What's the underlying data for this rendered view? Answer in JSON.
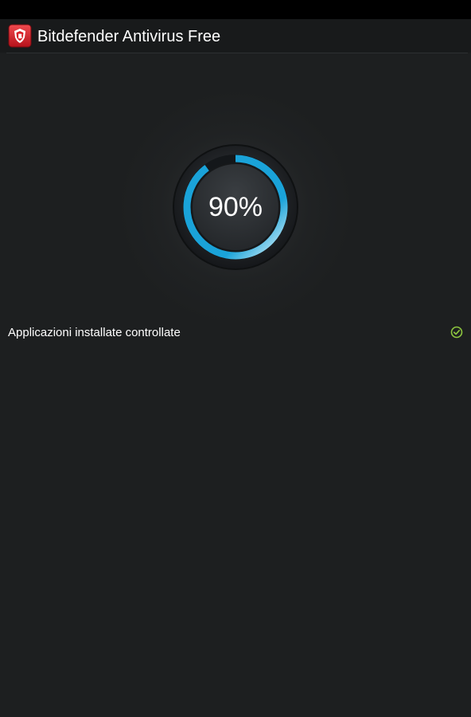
{
  "app": {
    "title": "Bitdefender Antivirus Free",
    "icon": "bitdefender-shield-icon"
  },
  "scan": {
    "progress_label": "90%",
    "progress_fraction": 0.9
  },
  "results": [
    {
      "label": "Applicazioni installate controllate",
      "status": "done",
      "icon": "check-circle-icon"
    }
  ],
  "colors": {
    "accent": "#1aa3d9",
    "accent_light": "#9fdcf0",
    "check": "#8dc63f",
    "brand_red": "#d81f26",
    "background": "#1d1f20"
  }
}
